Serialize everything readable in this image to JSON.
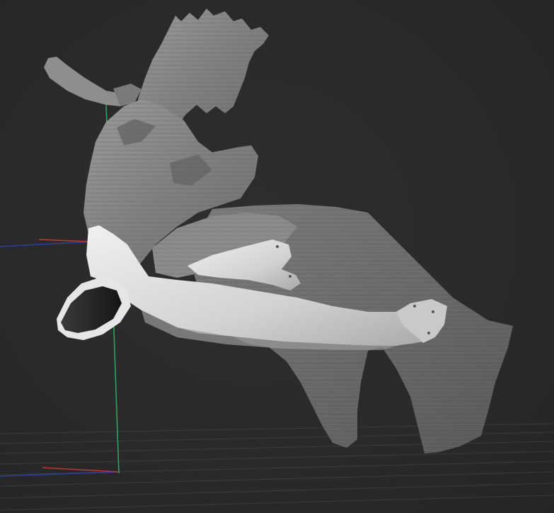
{
  "viewport": {
    "background": "#2a2a2a",
    "grid_color": "#4a4a4a",
    "axis_colors": {
      "x": "#c0392b",
      "y": "#27ae60",
      "z": "#2c3eaa"
    }
  },
  "model": {
    "raw_scan_color": "#8c8c8c",
    "cleaned_part_color": "#d6d6d6"
  }
}
